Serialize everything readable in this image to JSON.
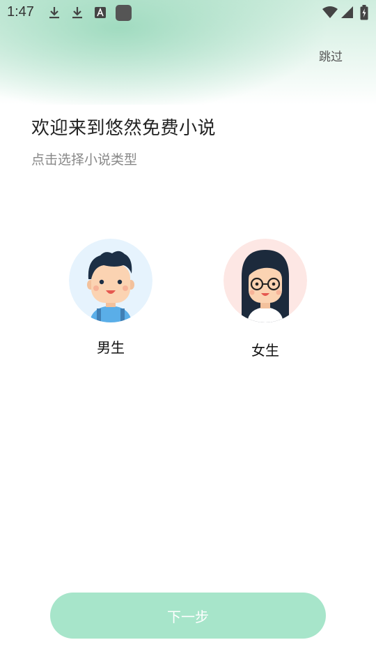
{
  "status_bar": {
    "time": "1:47",
    "icons": [
      "download-icon",
      "download-icon",
      "text-a-icon",
      "app-square-icon",
      "wifi-icon",
      "signal-icon",
      "battery-charging-icon"
    ]
  },
  "header": {
    "skip_label": "跳过"
  },
  "welcome": {
    "title": "欢迎来到悠然免费小说",
    "subtitle": "点击选择小说类型"
  },
  "genders": [
    {
      "label": "男生",
      "avatar": "boy-avatar",
      "bg_color": "#e6f3fd"
    },
    {
      "label": "女生",
      "avatar": "girl-avatar",
      "bg_color": "#fde7e4"
    }
  ],
  "footer": {
    "next_label": "下一步",
    "button_color": "#a7e5ca"
  }
}
